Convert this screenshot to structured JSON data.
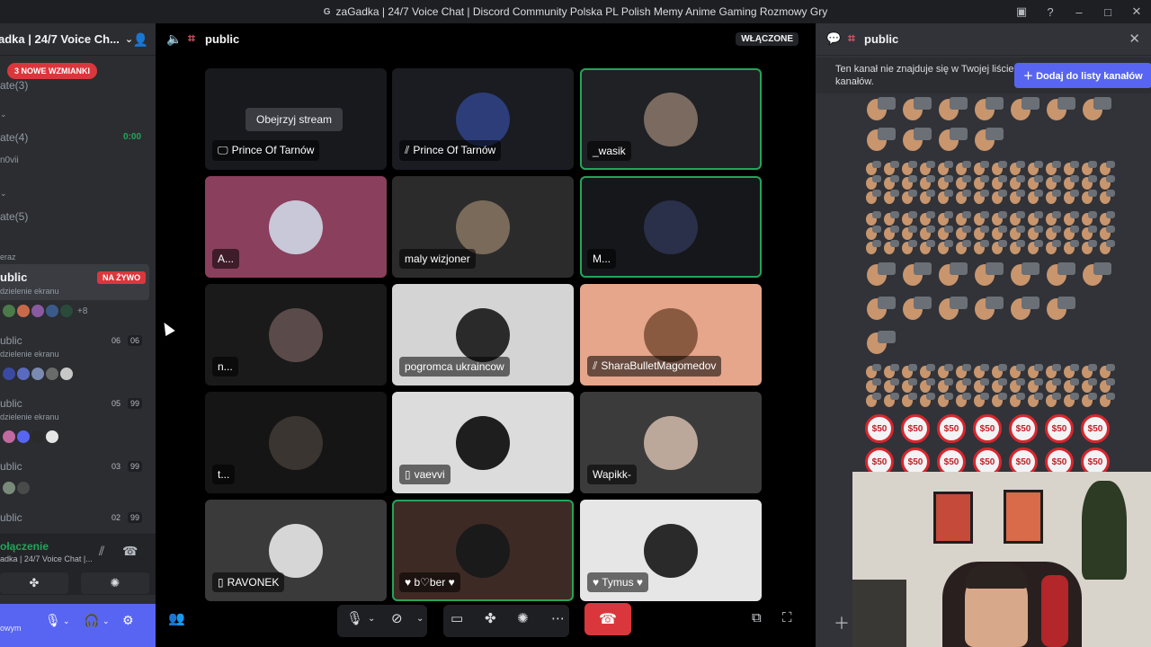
{
  "window": {
    "title": "zaGadka | 24/7 Voice Chat | Discord Community Polska PL Polish Memy Anime Gaming Rozmowy Gry",
    "favicon": "G"
  },
  "sidebar": {
    "server_name": "adka | 24/7 Voice Ch...",
    "mentions_badge": "3 NOWE WZMIANKI",
    "items": [
      {
        "label": "ate(3)"
      },
      {
        "label": "ate(4)",
        "timer": "0:00"
      },
      {
        "label": "n0vii"
      },
      {
        "label": "ate(5)"
      },
      {
        "label": "eraz"
      }
    ],
    "channels": [
      {
        "name": "ublic",
        "sub": "dzielenie ekranu",
        "badge": "NA ŻYWO",
        "more": "+8"
      },
      {
        "name": "ublic",
        "sub": "dzielenie ekranu",
        "count_a": "06",
        "count_b": "06"
      },
      {
        "name": "ublic",
        "sub": "dzielenie ekranu",
        "count_a": "05",
        "count_b": "99"
      },
      {
        "name": "ublic",
        "count_a": "03",
        "count_b": "99"
      },
      {
        "name": "ublic",
        "count_a": "02",
        "count_b": "99"
      }
    ],
    "connection": {
      "state": "ołączenie",
      "server": "adka | 24/7 Voice Chat |..."
    },
    "user_panel": {
      "sub": "owym"
    }
  },
  "main": {
    "channel": "public",
    "status_label": "WŁĄCZONE",
    "watch_stream_label": "Obejrzyj stream",
    "tiles": [
      {
        "name": "Prince Of Tarnów",
        "icon": "screen-icon",
        "bg": "#17191d",
        "speaking": false,
        "stream": true
      },
      {
        "name": "Prince Of Tarnów",
        "icon": "mute-icon",
        "bg": "#1a1c22",
        "speaking": false,
        "avatar": "#2c3d7a"
      },
      {
        "name": "_wasik",
        "bg": "#1f2124",
        "speaking": true,
        "avatar": "#7a6a60"
      },
      {
        "name": "A...",
        "bg": "#8a3f5c",
        "speaking": false,
        "avatar": "#c8c8d8"
      },
      {
        "name": "maly wizjoner",
        "bg": "#2b2b2b",
        "speaking": false,
        "avatar": "#7a6a5a"
      },
      {
        "name": "M...",
        "bg": "#16171b",
        "speaking": true,
        "avatar": "#2a2f4a"
      },
      {
        "name": "n...",
        "bg": "#1b1a1a",
        "speaking": false,
        "avatar": "#5a4a4a"
      },
      {
        "name": "pogromca ukraincow",
        "bg": "#d4d4d4",
        "speaking": false,
        "avatar": "#2a2a2a"
      },
      {
        "name": "SharaBulletMagomedov",
        "icon": "mute-icon",
        "bg": "#e6a68c",
        "speaking": false,
        "avatar": "#8a5a40"
      },
      {
        "name": "t...",
        "bg": "#151515",
        "speaking": false,
        "avatar": "#3a3530"
      },
      {
        "name": "vaevvi",
        "icon": "phone-icon",
        "bg": "#dcdcdc",
        "speaking": false,
        "avatar": "#1e1e1e"
      },
      {
        "name": "Wapikk-",
        "bg": "#3b3b3b",
        "speaking": false,
        "avatar": "#bba89a"
      },
      {
        "name": "RAVONEK",
        "icon": "phone-icon",
        "bg": "#3a3a3a",
        "speaking": false,
        "avatar": "#d6d6d6"
      },
      {
        "name": "♥ b♡ber ♥",
        "bg": "#3e2a24",
        "speaking": true,
        "avatar": "#1a1a1a"
      },
      {
        "name": "♥ Tymus ♥",
        "bg": "#e6e6e6",
        "speaking": false,
        "avatar": "#2a2a2a"
      }
    ]
  },
  "chat": {
    "channel": "public",
    "notice": "Ten kanał nie znajduje się w Twojej liście kanałów.",
    "add_button": "Dodaj do listy kanałów",
    "nope_text": "$50"
  },
  "colors": {
    "accent": "#5865f2",
    "danger": "#da373c",
    "speaking": "#23a55a"
  }
}
